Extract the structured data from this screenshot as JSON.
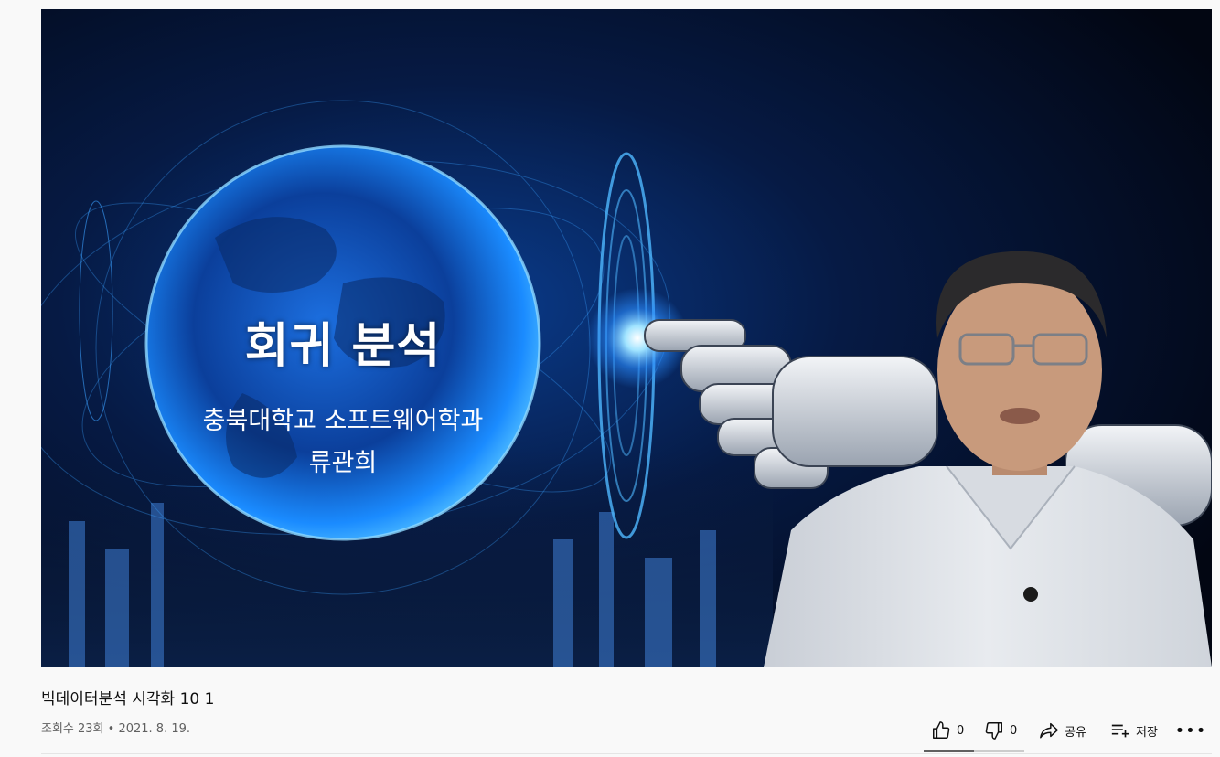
{
  "video": {
    "overlay_title": "회귀 분석",
    "overlay_affiliation": "충북대학교 소프트웨어학과",
    "overlay_name": "류관희"
  },
  "title": "빅데이터분석 시각화 10 1",
  "info": {
    "views": "조회수 23회",
    "separator": "•",
    "date": "2021. 8. 19."
  },
  "info_text": "조회수 23회 • 2021. 8. 19.",
  "actions": {
    "like_count": "0",
    "dislike_count": "0",
    "share_label": "공유",
    "save_label": "저장",
    "more_label": "•••"
  },
  "sentiment": {
    "like_fraction": 0.5
  },
  "icons": {
    "like": "thumbs-up-icon",
    "dislike": "thumbs-down-icon",
    "share": "share-arrow-icon",
    "save": "playlist-add-icon",
    "more": "more-horizontal-icon"
  },
  "colors": {
    "background": "#f9f9f9",
    "text_primary": "#0f0f0f",
    "text_secondary": "#606060",
    "video_glow": "#2a8cff"
  }
}
